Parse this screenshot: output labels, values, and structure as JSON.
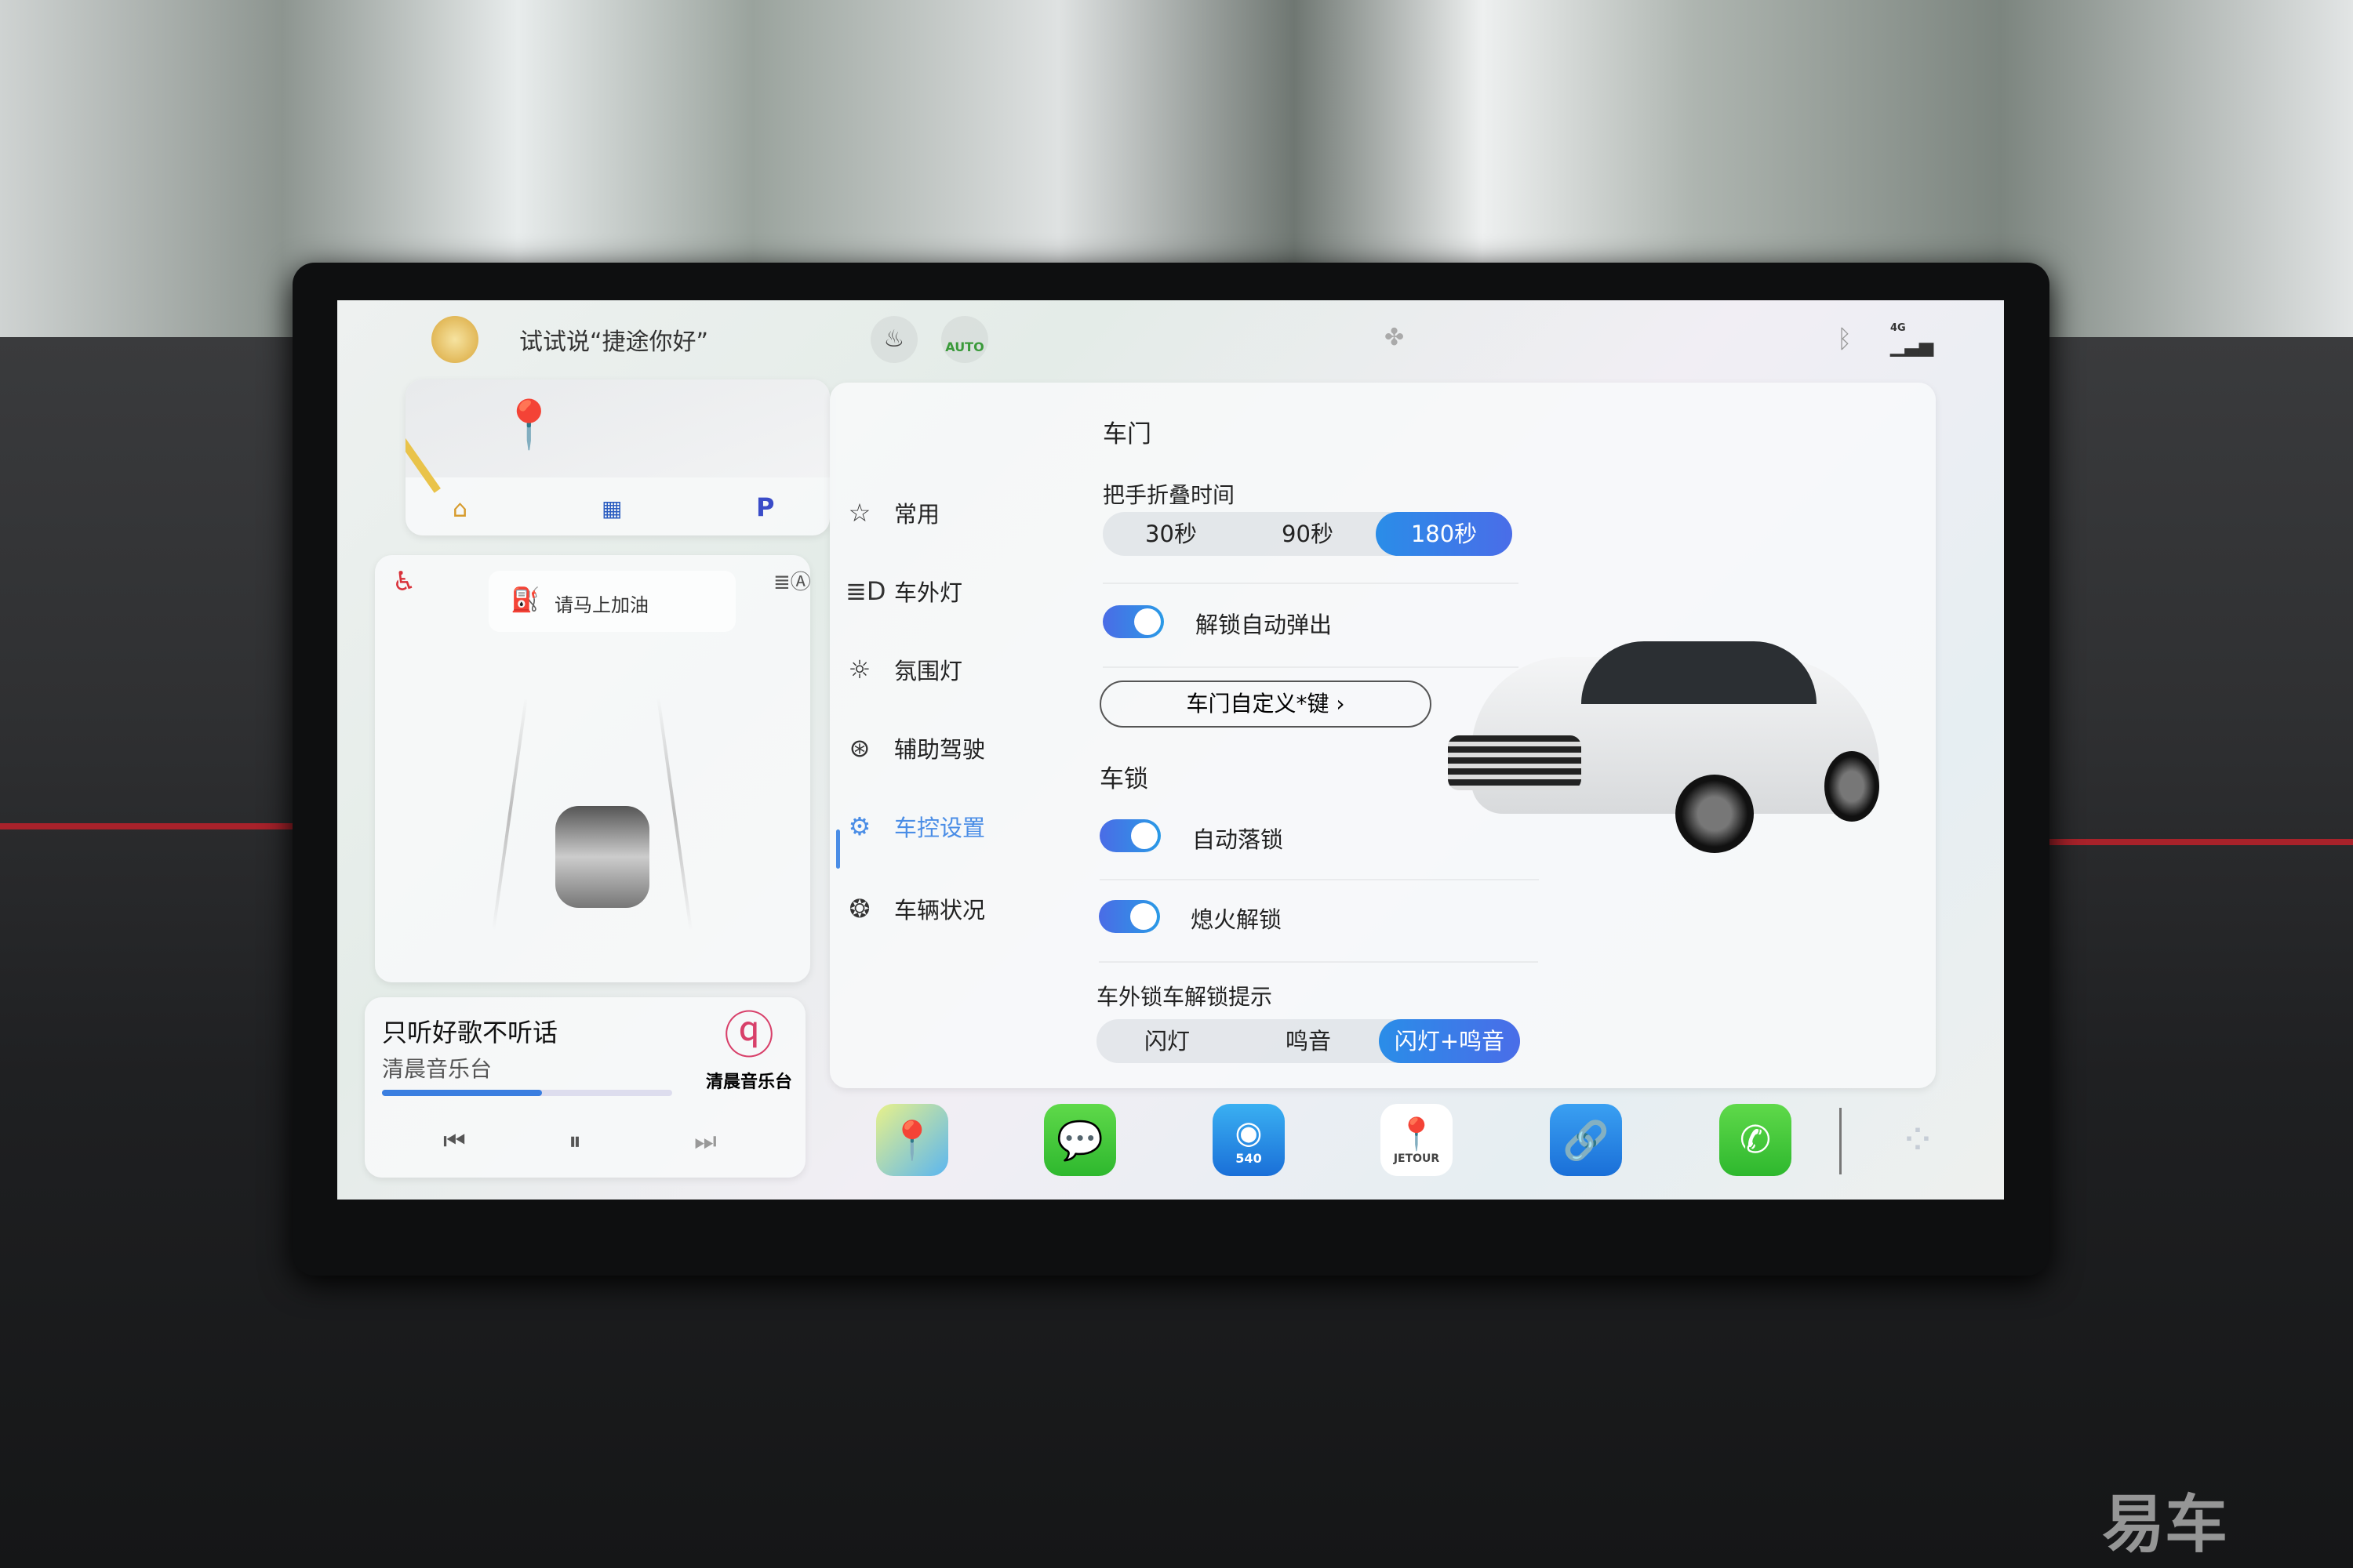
{
  "topbar": {
    "voice_hint": "试试说“捷途你好”",
    "auto_label": "AUTO",
    "network": "4G"
  },
  "map_card": {
    "shortcuts": [
      "home-icon",
      "office-icon",
      "P"
    ]
  },
  "alert_card": {
    "message": "请马上加油"
  },
  "music": {
    "title": "只听好歌不听话",
    "station": "清晨音乐台",
    "logo_text": "清晨音乐台",
    "progress": 0.55
  },
  "sidebar": {
    "items": [
      {
        "label": "常用",
        "icon": "star-icon"
      },
      {
        "label": "车外灯",
        "icon": "headlight-icon"
      },
      {
        "label": "氛围灯",
        "icon": "sun-icon"
      },
      {
        "label": "辅助驾驶",
        "icon": "steering-wheel-icon"
      },
      {
        "label": "车控设置",
        "icon": "gear-icon",
        "active": true
      },
      {
        "label": "车辆状况",
        "icon": "wheel-icon"
      }
    ]
  },
  "door": {
    "title": "车门",
    "fold_label": "把手折叠时间",
    "fold_options": [
      "30秒",
      "90秒",
      "180秒"
    ],
    "fold_selected": "180秒",
    "auto_popup_label": "解锁自动弹出",
    "auto_popup_on": true,
    "custom_key_label": "车门自定义*键 ›"
  },
  "lock": {
    "title": "车锁",
    "auto_lock_label": "自动落锁",
    "auto_lock_on": true,
    "off_unlock_label": "熄火解锁",
    "off_unlock_on": true,
    "hint_label": "车外锁车解锁提示",
    "hint_options": [
      "闪灯",
      "鸣音",
      "闪灯+鸣音"
    ],
    "hint_selected": "闪灯+鸣音"
  },
  "dock": {
    "apps": [
      "map-app",
      "wechat-app",
      "540-camera-app",
      "jetour-app",
      "link-app",
      "phone-app",
      "app-grid"
    ],
    "camera_label": "540",
    "jetour_label": "JETOUR"
  },
  "colors": {
    "accent": "#2a8de8",
    "alert": "#d9323a"
  },
  "watermark": "易车"
}
